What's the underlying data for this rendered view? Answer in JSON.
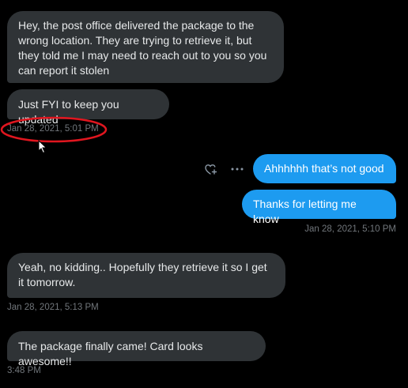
{
  "conversation": {
    "messages": [
      {
        "direction": "received",
        "text": "Hey, the post office delivered the package to the wrong location. They are trying to retrieve it, but they told me I may need to reach out to you so you can report it stolen"
      },
      {
        "direction": "received",
        "text": "Just FYI to keep you updated",
        "timestamp": "Jan 28, 2021, 5:01 PM"
      },
      {
        "direction": "sent",
        "text": "Ahhhhhh that’s not good"
      },
      {
        "direction": "sent",
        "text": "Thanks for letting me know",
        "timestamp": "Jan 28, 2021, 5:10 PM"
      },
      {
        "direction": "received",
        "text": "Yeah, no kidding.. Hopefully they retrieve it so I get it tomorrow.",
        "timestamp": "Jan 28, 2021, 5:13 PM"
      },
      {
        "direction": "received",
        "text": "The package finally came! Card looks awesome!!",
        "timestamp": "3:48 PM"
      }
    ]
  },
  "message_actions": {
    "react_icon": "heart-plus-icon",
    "more_icon": "more-horizontal-icon"
  },
  "annotation": {
    "shape": "ellipse",
    "color": "#e0161f",
    "marks": "timestamp Jan 28, 2021, 5:01 PM"
  },
  "cursor": {
    "icon": "arrow-cursor-icon"
  },
  "colors": {
    "background": "#000000",
    "received_bubble": "#2f3336",
    "sent_bubble": "#1d9bf0",
    "text": "#e7e9ea",
    "timestamp": "#71767b"
  }
}
